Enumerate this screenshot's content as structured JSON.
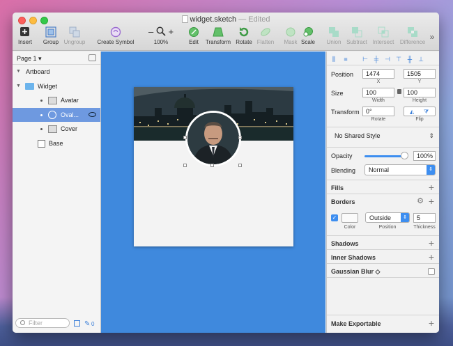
{
  "window": {
    "title": "widget.sketch",
    "title_suffix": "— Edited"
  },
  "toolbar": {
    "insert": "Insert",
    "group": "Group",
    "ungroup": "Ungroup",
    "create_symbol": "Create Symbol",
    "zoom_minus": "–",
    "zoom_plus": "+",
    "zoom": "100%",
    "edit": "Edit",
    "transform": "Transform",
    "rotate": "Rotate",
    "flatten": "Flatten",
    "mask": "Mask",
    "scale": "Scale",
    "union": "Union",
    "subtract": "Subtract",
    "intersect": "Intersect",
    "difference": "Difference",
    "more": "»"
  },
  "sidebar": {
    "page": "Page 1 ▾",
    "layers": {
      "artboard": "Artboard",
      "widget": "Widget",
      "avatar": "Avatar",
      "oval": "Oval...",
      "cover": "Cover",
      "base": "Base"
    },
    "filter_placeholder": "Filter",
    "count": "0"
  },
  "inspector": {
    "position_label": "Position",
    "x": "1474",
    "y": "1505",
    "x_label": "X",
    "y_label": "Y",
    "size_label": "Size",
    "width": "100",
    "height": "100",
    "width_label": "Width",
    "height_label": "Height",
    "transform_label": "Transform",
    "rotate": "0°",
    "rotate_label": "Rotate",
    "flip_label": "Flip",
    "shared_style": "No Shared Style",
    "opacity_label": "Opacity",
    "opacity": "100%",
    "blending_label": "Blending",
    "blending": "Normal",
    "fills": "Fills",
    "borders": "Borders",
    "border_color_label": "Color",
    "border_position": "Outside",
    "border_position_label": "Position",
    "border_thickness": "5",
    "border_thickness_label": "Thickness",
    "shadows": "Shadows",
    "inner_shadows": "Inner Shadows",
    "gaussian_blur": "Gaussian Blur ◇",
    "make_exportable": "Make Exportable"
  },
  "colors": {
    "canvas": "#3f89dd",
    "selection": "#6e99e0",
    "accent": "#3d8ef0"
  }
}
